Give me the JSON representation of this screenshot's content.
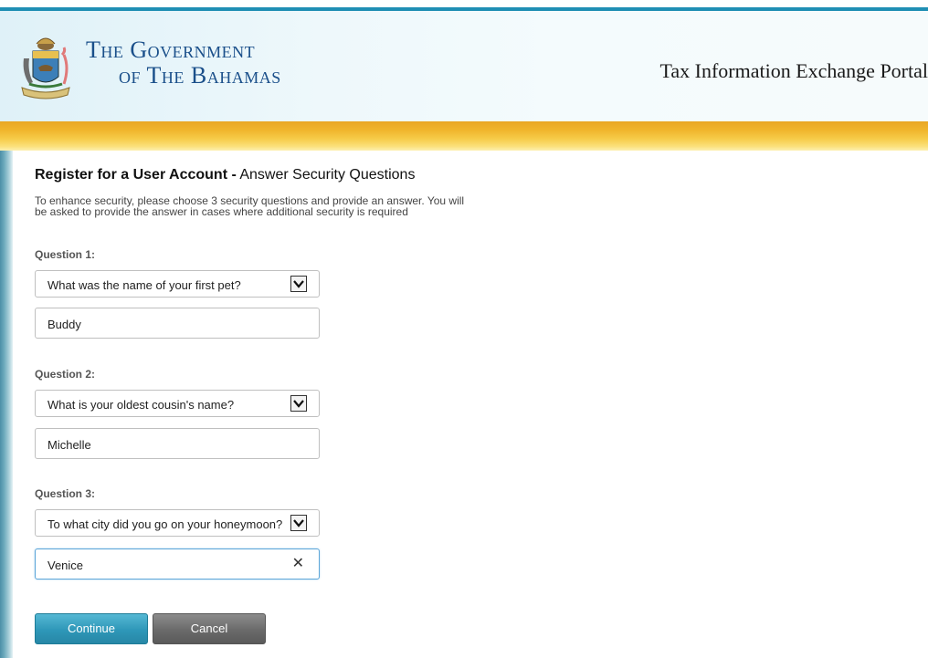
{
  "header": {
    "gov_line1": "The Government",
    "gov_line2": "of The Bahamas",
    "portal_title": "Tax Information Exchange Portal"
  },
  "page": {
    "title_bold": "Register for a User Account -",
    "title_rest": " Answer Security Questions",
    "intro_line1": "To enhance security, please choose 3 security questions and provide an answer. You will",
    "intro_line2": "be asked to provide the answer in cases where additional security is required"
  },
  "questions": [
    {
      "label": "Question 1:",
      "selected": "What was the name of your first pet?",
      "answer": "Buddy"
    },
    {
      "label": "Question 2:",
      "selected": "What is your oldest cousin's name?",
      "answer": "Michelle"
    },
    {
      "label": "Question 3:",
      "selected": "To what city did you go on your honeymoon?",
      "answer": "Venice",
      "clear_glyph": "✕"
    }
  ],
  "buttons": {
    "continue": "Continue",
    "cancel": "Cancel"
  },
  "colors": {
    "accent": "#2e97b8",
    "gold": "#f0b52c",
    "title_blue": "#1a4f8a"
  },
  "icons": {
    "crest": "coat-of-arms-icon",
    "dropdown": "chevron-down-icon",
    "clear": "clear-icon"
  }
}
